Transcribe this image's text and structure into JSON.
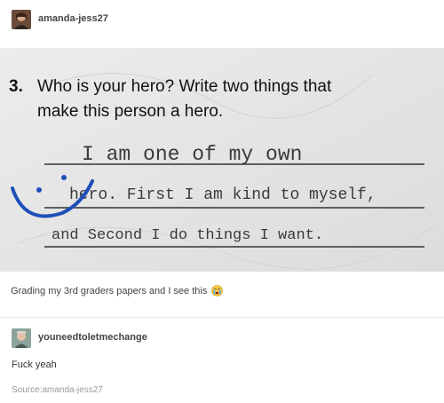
{
  "post": {
    "username": "amanda-jess27",
    "caption": "Grading my 3rd graders papers and I see this",
    "caption_emoji": "crying-face"
  },
  "worksheet": {
    "question_number": "3.",
    "question_line1": "Who is your hero? Write two things that",
    "question_line2": "make this person a hero.",
    "answer_line1": "I am one of my own",
    "answer_line2": "hero. First I am kind to myself,",
    "answer_line3": "and Second I do things I want.",
    "smiley_color": "#1f4fb8"
  },
  "reply": {
    "username": "youneedtoletmechange",
    "text": "Fuck yeah"
  },
  "source": {
    "text": "Source:amanda-jess27"
  }
}
